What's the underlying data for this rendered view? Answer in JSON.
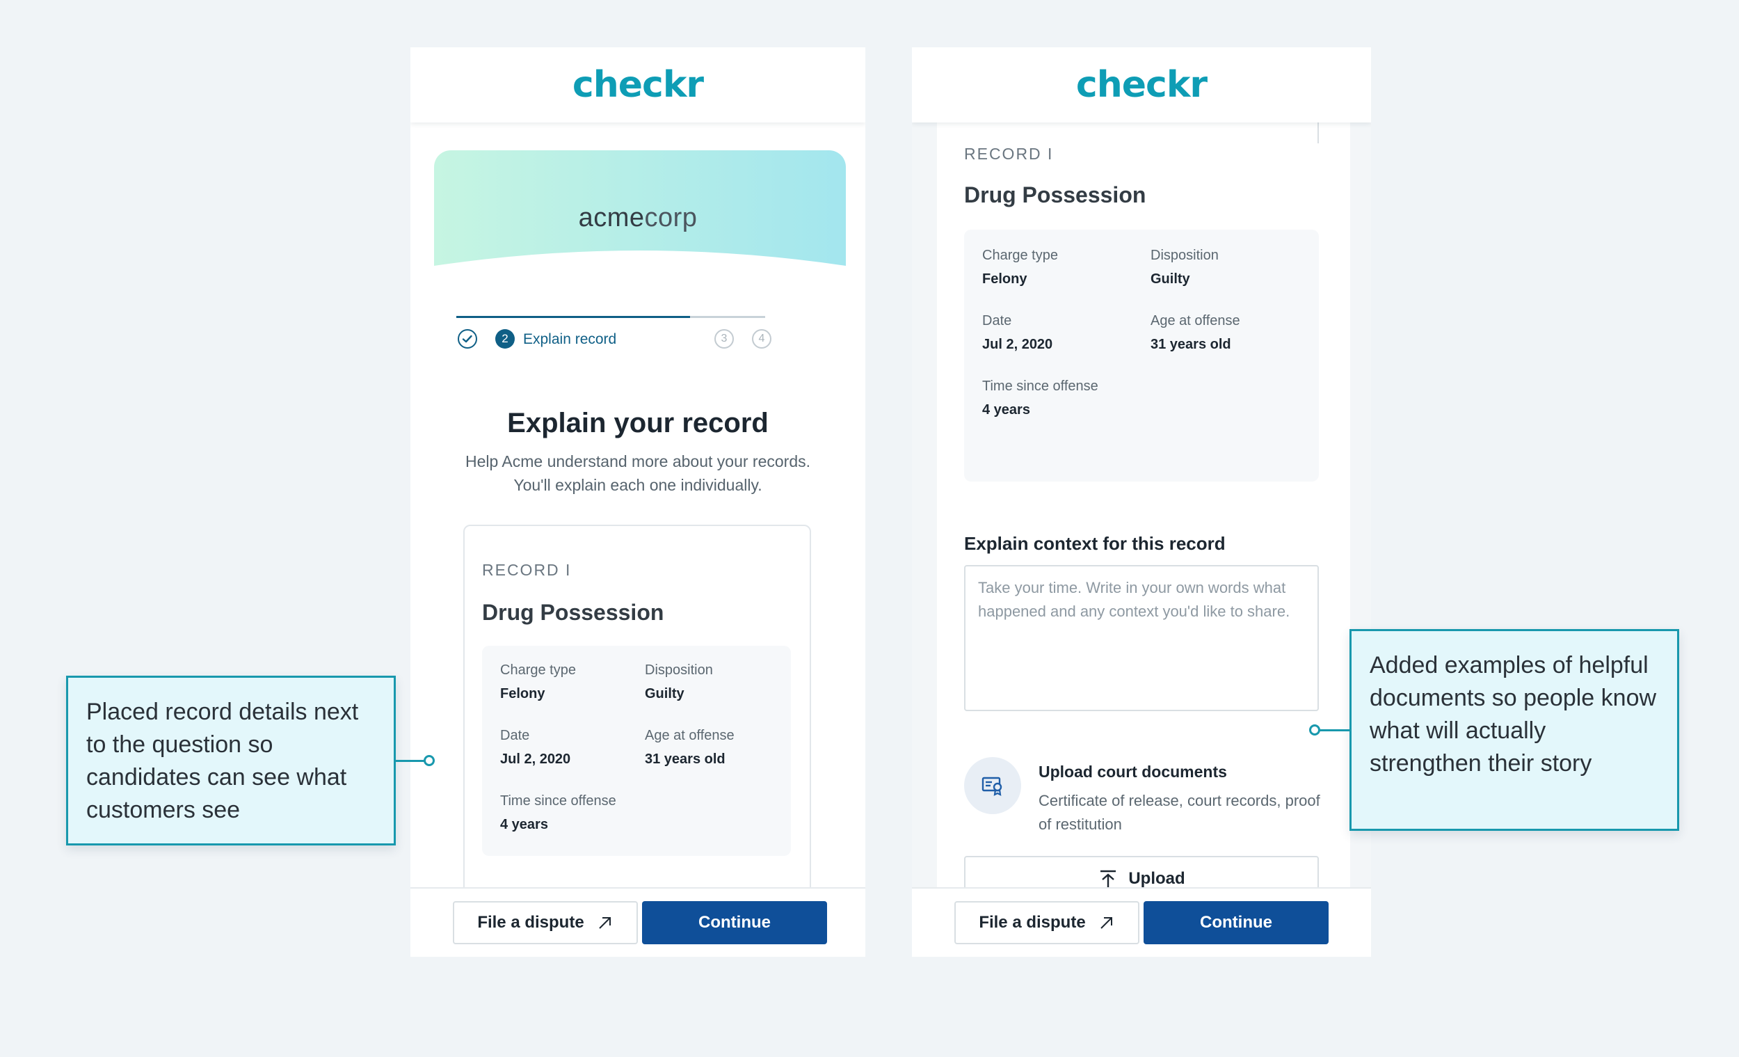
{
  "brand": {
    "logo": "checkr",
    "accent": "#0e9db5",
    "primary": "#0f4f99"
  },
  "screen1": {
    "company": {
      "part1": "acme",
      "part2": "corp"
    },
    "stepper": {
      "step1_icon": "check-icon",
      "step2_number": "2",
      "step2_label": "Explain record",
      "step3_number": "3",
      "step4_number": "4"
    },
    "title": "Explain your record",
    "subtitle": "Help Acme understand more about your records. You'll explain each one individually.",
    "record": {
      "eyebrow": "RECORD I",
      "title": "Drug Possession",
      "charge_type_label": "Charge type",
      "charge_type_value": "Felony",
      "disposition_label": "Disposition",
      "disposition_value": "Guilty",
      "date_label": "Date",
      "date_value": "Jul 2, 2020",
      "age_label": "Age at offense",
      "age_value": "31 years old",
      "time_label": "Time since offense",
      "time_value": "4 years"
    },
    "footer": {
      "dispute": "File a dispute",
      "continue": "Continue"
    }
  },
  "screen2": {
    "record": {
      "eyebrow": "RECORD I",
      "title": "Drug Possession",
      "charge_type_label": "Charge type",
      "charge_type_value": "Felony",
      "disposition_label": "Disposition",
      "disposition_value": "Guilty",
      "date_label": "Date",
      "date_value": "Jul 2, 2020",
      "age_label": "Age at offense",
      "age_value": "31 years old",
      "time_label": "Time since offense",
      "time_value": "4 years"
    },
    "context": {
      "label": "Explain context for this record",
      "placeholder": "Take your time. Write in your own words what happened and any context you'd like to share."
    },
    "upload": {
      "title": "Upload court documents",
      "description": "Certificate of release, court records, proof of restitution",
      "button": "Upload"
    },
    "footer": {
      "dispute": "File a dispute",
      "continue": "Continue"
    }
  },
  "annotations": {
    "left": "Placed record details next to the question so candidates can see what customers see",
    "right": "Added examples of helpful documents so people know what will actually strengthen their story"
  }
}
